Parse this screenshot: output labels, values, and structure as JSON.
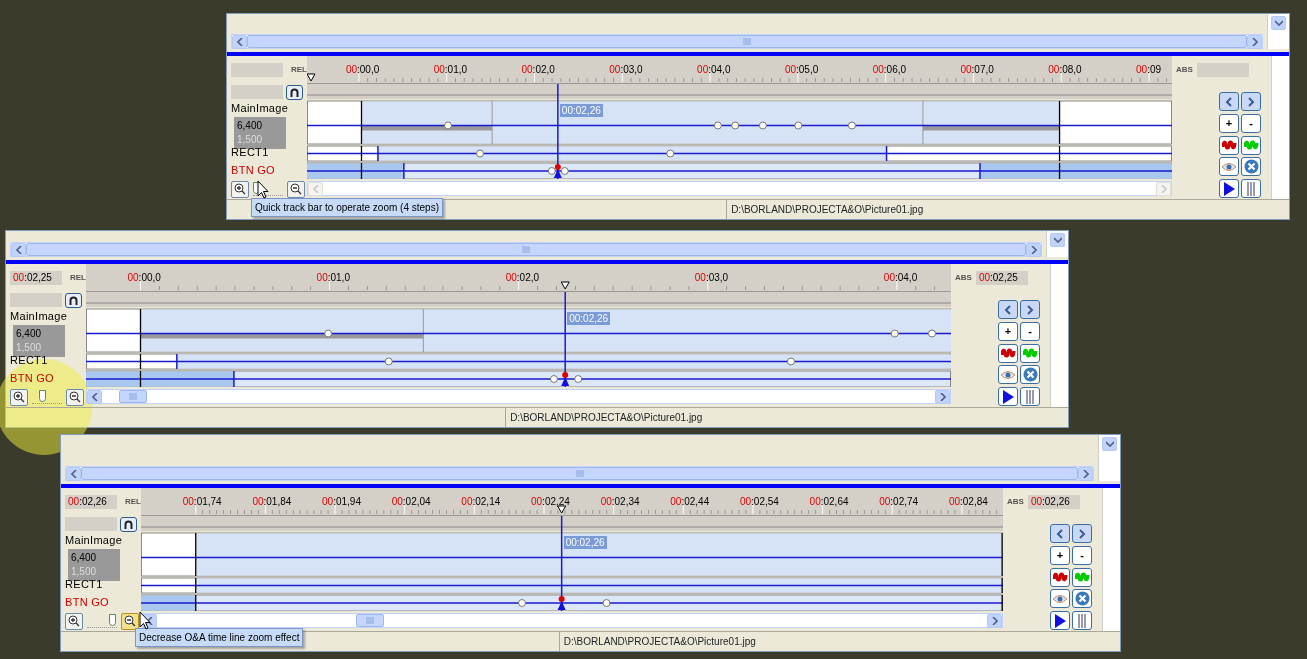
{
  "panels": [
    {
      "rel_label": "REL",
      "abs_label": "ABS",
      "ruler": [
        {
          "prefix": "00",
          "rest": ":00,0"
        },
        {
          "prefix": "00",
          "rest": ":01,0"
        },
        {
          "prefix": "00",
          "rest": ":02,0"
        },
        {
          "prefix": "00",
          "rest": ":03,0"
        },
        {
          "prefix": "00",
          "rest": ":04,0"
        },
        {
          "prefix": "00",
          "rest": ":05,0"
        },
        {
          "prefix": "00",
          "rest": ":06,0"
        },
        {
          "prefix": "00",
          "rest": ":07,0"
        },
        {
          "prefix": "00",
          "rest": ":08,0"
        },
        {
          "prefix": "00",
          "rest": ":09"
        }
      ],
      "playhead_time": "00:02,26",
      "tracks": [
        {
          "name": "MainImage",
          "values": [
            "6,400",
            "1,500"
          ],
          "color": "#000000"
        },
        {
          "name": "RECT1",
          "color": "#000000"
        },
        {
          "name": "BTN GO",
          "color": "#cc0000"
        }
      ],
      "buttons": [
        {
          "kind": "prev"
        },
        {
          "kind": "next"
        },
        {
          "kind": "text",
          "label": "+"
        },
        {
          "kind": "text",
          "label": "-"
        },
        {
          "kind": "wave",
          "color": "#cc0000"
        },
        {
          "kind": "wave",
          "color": "#00cc00"
        },
        {
          "kind": "eye"
        },
        {
          "kind": "remove"
        },
        {
          "kind": "play"
        },
        {
          "kind": "pause"
        }
      ],
      "zoom": {
        "level": 0,
        "zoom_out_highlighted": false
      },
      "hscroll": {
        "disabled": true
      },
      "status_path": "D:\\BORLAND\\PROJECTA&O\\Picture01.jpg",
      "tooltip": "Quick track bar to operate zoom (4 steps)",
      "pointer": {
        "kind": "arrow"
      }
    },
    {
      "rel_time": {
        "prefix": "00",
        "rest": ":02,25"
      },
      "rel_label": "REL",
      "abs_label": "ABS",
      "abs_time": {
        "prefix": "00",
        "rest": ":02,25"
      },
      "ruler": [
        {
          "prefix": "00",
          "rest": ":00,0"
        },
        {
          "prefix": "00",
          "rest": ":01,0"
        },
        {
          "prefix": "00",
          "rest": ":02,0"
        },
        {
          "prefix": "00",
          "rest": ":03,0"
        },
        {
          "prefix": "00",
          "rest": ":04,0"
        }
      ],
      "playhead_time": "00:02,26",
      "tracks": [
        {
          "name": "MainImage",
          "values": [
            "6,400",
            "1,500"
          ],
          "color": "#000000"
        },
        {
          "name": "RECT1",
          "color": "#000000"
        },
        {
          "name": "BTN GO",
          "color": "#cc0000"
        }
      ],
      "buttons": [
        {
          "kind": "prev"
        },
        {
          "kind": "next"
        },
        {
          "kind": "text",
          "label": "+"
        },
        {
          "kind": "text",
          "label": "-"
        },
        {
          "kind": "wave",
          "color": "#cc0000"
        },
        {
          "kind": "wave",
          "color": "#00cc00"
        },
        {
          "kind": "eye"
        },
        {
          "kind": "remove"
        },
        {
          "kind": "play"
        },
        {
          "kind": "pause"
        }
      ],
      "zoom": {
        "level": 0.33,
        "zoom_out_highlighted": false
      },
      "hscroll": {
        "disabled": false
      },
      "status_path": "D:\\BORLAND\\PROJECTA&O\\Picture01.jpg",
      "pointer": {
        "kind": "highlight"
      }
    },
    {
      "rel_time": {
        "prefix": "00",
        "rest": ":02,26"
      },
      "rel_label": "REL",
      "abs_label": "ABS",
      "abs_time": {
        "prefix": "00",
        "rest": ":02,26"
      },
      "ruler": [
        {
          "prefix": "00",
          "rest": ":01,74"
        },
        {
          "prefix": "00",
          "rest": ":01,84"
        },
        {
          "prefix": "00",
          "rest": ":01,94"
        },
        {
          "prefix": "00",
          "rest": ":02,04"
        },
        {
          "prefix": "00",
          "rest": ":02,14"
        },
        {
          "prefix": "00",
          "rest": ":02,24"
        },
        {
          "prefix": "00",
          "rest": ":02,34"
        },
        {
          "prefix": "00",
          "rest": ":02,44"
        },
        {
          "prefix": "00",
          "rest": ":02,54"
        },
        {
          "prefix": "00",
          "rest": ":02,64"
        },
        {
          "prefix": "00",
          "rest": ":02,74"
        },
        {
          "prefix": "00",
          "rest": ":02,84"
        }
      ],
      "playhead_time": "00:02,26",
      "tracks": [
        {
          "name": "MainImage",
          "values": [
            "6,400",
            "1,500"
          ],
          "color": "#000000"
        },
        {
          "name": "RECT1",
          "color": "#000000"
        },
        {
          "name": "BTN GO",
          "color": "#cc0000"
        }
      ],
      "buttons": [
        {
          "kind": "prev"
        },
        {
          "kind": "next"
        },
        {
          "kind": "text",
          "label": "+"
        },
        {
          "kind": "text",
          "label": "-"
        },
        {
          "kind": "wave",
          "color": "#cc0000"
        },
        {
          "kind": "wave",
          "color": "#00cc00"
        },
        {
          "kind": "eye"
        },
        {
          "kind": "remove"
        },
        {
          "kind": "play"
        },
        {
          "kind": "pause"
        }
      ],
      "zoom": {
        "level": 1,
        "zoom_out_highlighted": true
      },
      "hscroll": {
        "disabled": false
      },
      "status_path": "D:\\BORLAND\\PROJECTA&O\\Picture01.jpg",
      "tooltip": "Decrease O&A time line zoom effect",
      "pointer": {
        "kind": "arrow"
      }
    }
  ]
}
